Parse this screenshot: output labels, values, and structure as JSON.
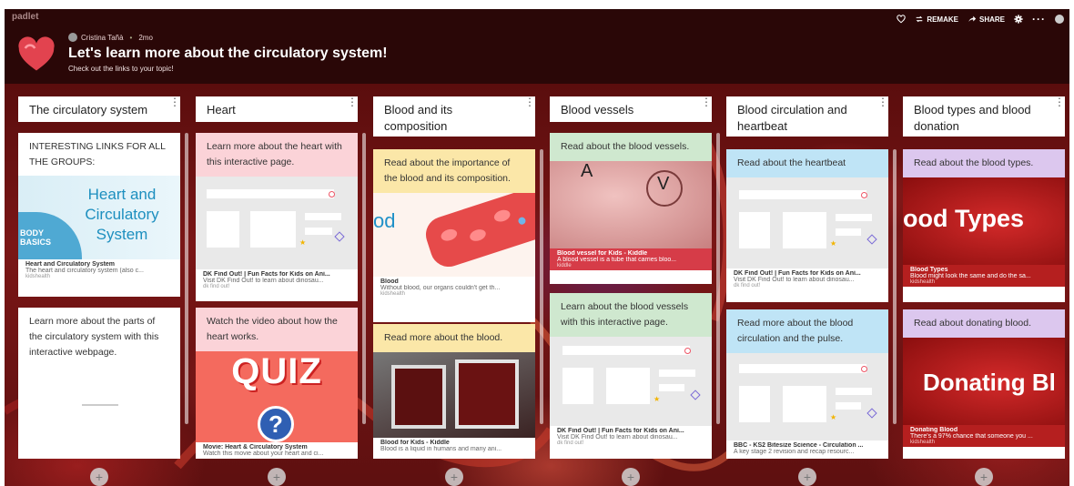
{
  "app": {
    "brand": "padlet"
  },
  "toolbar": {
    "remake_label": "REMAKE",
    "share_label": "SHARE"
  },
  "header": {
    "author": "Cristina Tañà",
    "age": "2mo",
    "title": "Let's learn more about the circulatory system!",
    "subtitle": "Check out the links to your topic!"
  },
  "colors": {
    "pink": "#fbd3d8",
    "yellow": "#fbe7a8",
    "green": "#cfe8cf",
    "blue": "#bfe4f6",
    "lilac": "#dcc7ee",
    "topbar": "#2a0707"
  },
  "columns": [
    {
      "title": "The circulatory system",
      "cards": [
        {
          "caption": "INTERESTING LINKS FOR ALL THE GROUPS:",
          "thumb_text_1": "Heart and",
          "thumb_text_2": "Circulatory",
          "thumb_text_3": "System",
          "thumb_badge_1": "BODY",
          "thumb_badge_2": "BASICS",
          "link_title": "Heart and Circulatory System",
          "link_desc": "The heart and circulatory system (also c...",
          "link_src": "kidshealth"
        },
        {
          "caption": "Learn more about the parts of the circulatory system with this interactive webpage."
        }
      ]
    },
    {
      "title": "Heart",
      "cards": [
        {
          "caption": "Learn more about the heart with this interactive page.",
          "link_title": "DK Find Out! | Fun Facts for Kids on Ani...",
          "link_desc": "Visit DK Find Out! to learn about dinosau...",
          "link_src": "dk find out!"
        },
        {
          "caption": "Watch the video about how the heart works.",
          "thumb_text": "QUIZ",
          "link_title": "Movie: Heart & Circulatory System",
          "link_desc": "Watch this movie about your heart and ci..."
        }
      ]
    },
    {
      "title": "Blood and its composition",
      "cards": [
        {
          "caption": "Read about the importance of the blood and its composition.",
          "thumb_text": "od",
          "link_title": "Blood",
          "link_desc": "Without blood, our organs couldn't get th...",
          "link_src": "kidshealth"
        },
        {
          "caption": "Read more about the blood.",
          "link_title": "Blood for Kids - Kiddle",
          "link_desc": "Blood is a liquid in humans and many ani..."
        }
      ]
    },
    {
      "title": "Blood vessels",
      "cards": [
        {
          "caption": "Read about the blood vessels.",
          "thumb_label_a": "A",
          "thumb_label_v": "V",
          "link_title": "Blood vessel for Kids - Kiddle",
          "link_desc": "A blood vessel is a tube that carries bloo...",
          "link_src": "kiddle"
        },
        {
          "caption": "Learn about the blood vessels with this interactive page.",
          "link_title": "DK Find Out! | Fun Facts for Kids on Ani...",
          "link_desc": "Visit DK Find Out! to learn about dinosau...",
          "link_src": "dk find out!"
        }
      ]
    },
    {
      "title": "Blood circulation and heartbeat",
      "cards": [
        {
          "caption": "Read about the heartbeat",
          "link_title": "DK Find Out! | Fun Facts for Kids on Ani...",
          "link_desc": "Visit DK Find Out! to learn about dinosau...",
          "link_src": "dk find out!"
        },
        {
          "caption": "Read more about the blood circulation and the pulse.",
          "link_title": "BBC - KS2 Bitesize Science - Circulation ...",
          "link_desc": "A key stage 2 revision and recap resourc..."
        }
      ]
    },
    {
      "title": "Blood types and blood donation",
      "cards": [
        {
          "caption": "Read about the blood types.",
          "thumb_text": "ood Types",
          "link_title": "Blood Types",
          "link_desc": "Blood might look the same and do the sa...",
          "link_src": "kidshealth"
        },
        {
          "caption": "Read about donating blood.",
          "thumb_text": "Donating Bl",
          "link_title": "Donating Blood",
          "link_desc": "There's a 97% chance that someone you ...",
          "link_src": "kidshealth"
        }
      ]
    }
  ]
}
